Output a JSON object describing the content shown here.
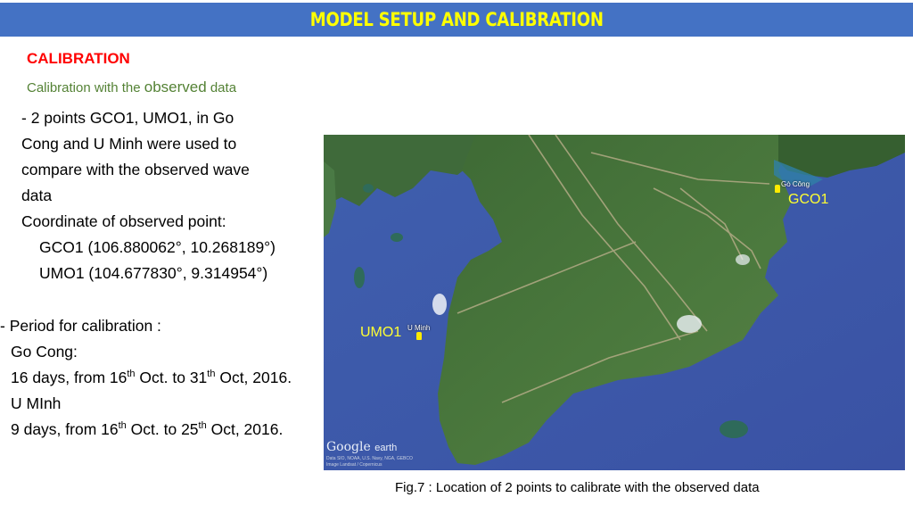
{
  "header": {
    "title": "MODEL SETUP AND CALIBRATION",
    "bg_color": "#4472c4",
    "title_color": "#ffff00"
  },
  "section": {
    "title": "CALIBRATION",
    "title_color": "#ff0000",
    "subtitle_prefix": "Calibration with the ",
    "subtitle_emphasis": "observed",
    "subtitle_suffix": " data",
    "subtitle_color": "#548235"
  },
  "points_description": {
    "lines": [
      "- 2 points GCO1, UMO1, in Go",
      "Cong and U Minh were used to",
      "compare with the observed wave",
      "data"
    ]
  },
  "coordinates": {
    "label": "Coordinate of observed point:",
    "points": [
      {
        "text": "GCO1 (106.880062°, 10.268189°)"
      },
      {
        "text": "UMO1 (104.677830°, 9.314954°)"
      }
    ]
  },
  "period": {
    "label": "- Period for calibration :",
    "stations": [
      {
        "name": "Go Cong:",
        "days_prefix": "16 days, from 16",
        "sup1": "th",
        "mid": " Oct. to 31",
        "sup2": "th",
        "suffix": " Oct, 2016."
      },
      {
        "name": "U MInh",
        "days_prefix": "9 days, from 16",
        "sup1": "th",
        "mid": " Oct. to 25",
        "sup2": "th",
        "suffix": " Oct, 2016."
      }
    ]
  },
  "map": {
    "markers": [
      {
        "id": "GCO1",
        "label": "GCO1",
        "place": "Gò Công"
      },
      {
        "id": "UMO1",
        "label": "UMO1",
        "place": "U Minh"
      }
    ],
    "logo": {
      "google": "Google",
      "earth": "earth"
    },
    "credits": [
      "Data SIO, NOAA, U.S. Navy, NGA, GEBCO",
      "Image Landsat / Copernicus"
    ],
    "marker_label_color": "#ffff33"
  },
  "caption": "Fig.7 : Location of 2 points to calibrate with the observed data"
}
